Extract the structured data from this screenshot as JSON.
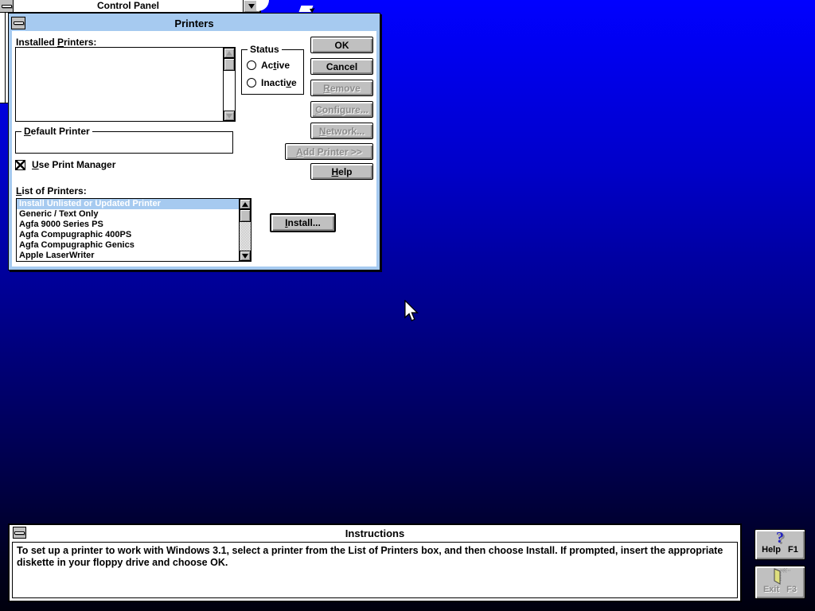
{
  "colors": {
    "desktop_top": "#0000ff",
    "desktop_bottom": "#000008",
    "titlebar_active": "#a6caf0",
    "titlebar_inactive": "#ffffff",
    "button_face": "#c0c0c0",
    "selection_bg": "#a6caf0",
    "selection_text": "#ffffff",
    "help_question_mark": "#2424bf",
    "exit_door": "#dede7e"
  },
  "control_panel": {
    "title": "Control Panel"
  },
  "printers_dialog": {
    "title": "Printers",
    "installed_printers": {
      "label": {
        "text": "Installed Printers:",
        "u": 10
      },
      "items": []
    },
    "status_group": {
      "label": "Status",
      "active": {
        "text": "Active",
        "u": 2,
        "enabled": false
      },
      "inactive": {
        "text": "Inactive",
        "u": 6,
        "enabled": false
      }
    },
    "default_printer": {
      "label": {
        "text": "Default Printer",
        "u": 0
      },
      "value": ""
    },
    "use_print_manager": {
      "label": {
        "text": "Use Print Manager",
        "u": 0
      },
      "checked": true
    },
    "list_of_printers": {
      "label": {
        "text": "List of Printers:",
        "u": 0
      },
      "items": [
        "Install Unlisted or Updated Printer",
        "Generic / Text Only",
        "Agfa 9000 Series PS",
        "Agfa Compugraphic 400PS",
        "Agfa Compugraphic Genics",
        "Apple LaserWriter"
      ],
      "selected": "Install Unlisted or Updated Printer"
    },
    "buttons": {
      "ok": {
        "text": "OK",
        "u": -1,
        "enabled": true
      },
      "cancel": {
        "text": "Cancel",
        "u": -1,
        "enabled": true
      },
      "remove": {
        "text": "Remove",
        "u": 0,
        "enabled": false
      },
      "configure": {
        "text": "Configure...",
        "u": 0,
        "enabled": false
      },
      "network": {
        "text": "Network...",
        "u": 0,
        "enabled": false
      },
      "add_printer": {
        "text": "Add Printer >>",
        "u": 0,
        "enabled": false
      },
      "help": {
        "text": "Help",
        "u": 0,
        "enabled": true
      },
      "install": {
        "text": "Install...",
        "u": 0,
        "enabled": true
      }
    }
  },
  "instructions_window": {
    "title": "Instructions",
    "body": "To set up a printer to work with Windows 3.1, select a printer from the List of Printers box, and then choose Install. If prompted, insert the appropriate diskette in your floppy drive and choose OK."
  },
  "side_buttons": {
    "help": {
      "label": "Help F1",
      "icon": "?",
      "enabled": true
    },
    "exit": {
      "label": "Exit F3",
      "enabled": false
    }
  }
}
